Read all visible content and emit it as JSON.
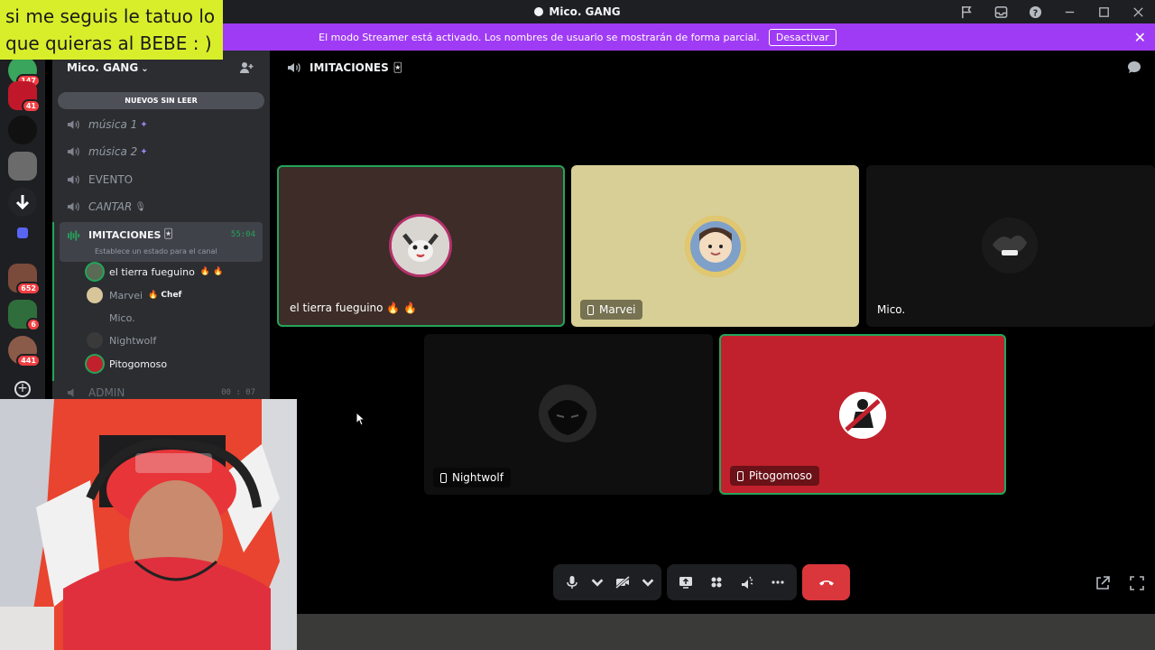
{
  "window": {
    "title": "Mico. GANG"
  },
  "banner": {
    "text": "El modo Streamer está activado. Los nombres de usuario se mostrarán de forma parcial.",
    "button": "Desactivar",
    "close": "✕"
  },
  "caption": {
    "line1": "si me seguis le tatuo lo",
    "line2": "que quieras al BEBE : )"
  },
  "rail": {
    "servers": [
      {
        "badge": "147"
      },
      {
        "badge": "41"
      },
      {
        "badge": ""
      },
      {
        "badge": ""
      },
      {
        "badge": ""
      },
      {
        "badge": ""
      },
      {
        "badge": "652"
      },
      {
        "badge": "6"
      },
      {
        "badge": "441"
      }
    ],
    "add": "+"
  },
  "sidebar": {
    "server_name": "Mico. GANG",
    "unread_pill": "NUEVOS SIN LEER",
    "channels": [
      {
        "name": "música 1",
        "emoji": "✦",
        "italic": true
      },
      {
        "name": "música 2",
        "emoji": "✦",
        "italic": true
      },
      {
        "name": "EVENTO",
        "emoji": "",
        "italic": false
      },
      {
        "name": "CANTAR",
        "emoji": "🎙",
        "italic": true
      }
    ],
    "active_channel": {
      "name": "IMITACIONES",
      "emoji": "🃏",
      "timer": "55:04",
      "status": "Establece un estado para el canal"
    },
    "voice_users": [
      {
        "name": "el tierra fueguino",
        "suffix": "🔥 🔥"
      },
      {
        "name": "Marvei",
        "suffix": "🔥 Chef"
      },
      {
        "name": "Mico.",
        "suffix": ""
      },
      {
        "name": "Nightwolf",
        "suffix": ""
      },
      {
        "name": "Pitogomoso",
        "suffix": ""
      }
    ],
    "next_channel": {
      "name": "ADMIN",
      "timer": "00 : 07"
    }
  },
  "voice": {
    "channel_name": "IMITACIONES",
    "channel_emoji": "🃏",
    "tiles": [
      {
        "name": "el tierra fueguino 🔥 🔥",
        "mobile": false,
        "bg": "#3d2c27",
        "speaking": true
      },
      {
        "name": "Marvei",
        "mobile": true,
        "bg": "#d8cf96",
        "speaking": false
      },
      {
        "name": "Mico.",
        "mobile": false,
        "bg": "#121212",
        "speaking": false
      },
      {
        "name": "Nightwolf",
        "mobile": true,
        "bg": "#0f0f0f",
        "speaking": false
      },
      {
        "name": "Pitogomoso",
        "mobile": true,
        "bg": "#c1212c",
        "speaking": true
      }
    ]
  },
  "colors": {
    "accent_green": "#23a55a",
    "streamer_purple": "#a03bf5",
    "hangup_red": "#da373c",
    "caption_yellow": "#d8ee2a"
  }
}
